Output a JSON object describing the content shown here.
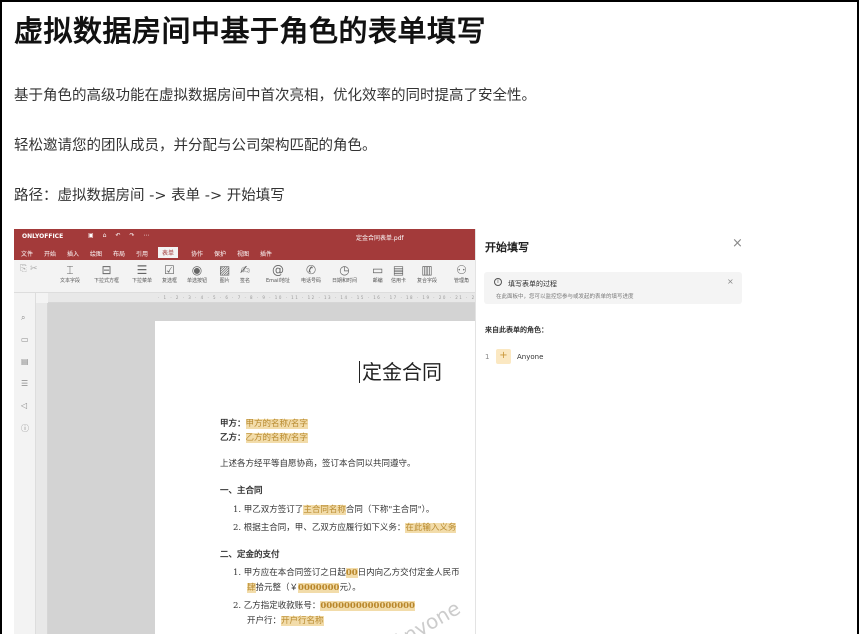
{
  "article": {
    "title": "虚拟数据房间中基于角色的表单填写",
    "paragraphs": [
      "基于角色的高级功能在虚拟数据房间中首次亮相，优化效率的同时提高了安全性。",
      "轻松邀请您的团队成员，并分配与公司架构匹配的角色。",
      "路径：虚拟数据房间 -> 表单 -> 开始填写"
    ]
  },
  "app": {
    "logo": "ONLYOFFICE",
    "document_name": "定金合同表单.pdf",
    "brand_color": "#a33a3a",
    "menu": [
      "文件",
      "开始",
      "插入",
      "绘图",
      "布局",
      "引用",
      "表单",
      "协作",
      "保护",
      "视图",
      "插件"
    ],
    "active_menu": "表单",
    "ribbon": [
      {
        "label": "文本字段",
        "icon": "text-field-icon",
        "glyph": "⌶"
      },
      {
        "label": "下拉式方框",
        "icon": "combo-box-icon",
        "glyph": "⊟"
      },
      {
        "label": "下拉菜单",
        "icon": "dropdown-icon",
        "glyph": "☰"
      },
      {
        "label": "复选框",
        "icon": "checkbox-icon",
        "glyph": "☑"
      },
      {
        "label": "单选按钮",
        "icon": "radio-icon",
        "glyph": "◉"
      },
      {
        "label": "图片",
        "icon": "image-icon",
        "glyph": "▨"
      },
      {
        "label": "签名",
        "icon": "signature-icon",
        "glyph": "✍"
      },
      {
        "label": "Email地址",
        "icon": "email-icon",
        "glyph": "@"
      },
      {
        "label": "电话号码",
        "icon": "phone-icon",
        "glyph": "✆"
      },
      {
        "label": "日期和时间",
        "icon": "datetime-icon",
        "glyph": "◷"
      },
      {
        "label": "邮编",
        "icon": "zip-icon",
        "glyph": "▭"
      },
      {
        "label": "信用卡",
        "icon": "credit-card-icon",
        "glyph": "▤"
      },
      {
        "label": "复合字段",
        "icon": "complex-field-icon",
        "glyph": "▥"
      },
      {
        "label": "管理角",
        "icon": "manage-roles-icon",
        "glyph": "⚇"
      }
    ]
  },
  "document": {
    "title": "定金合同",
    "party_a_label": "甲方：",
    "party_a_value": "甲方的名称/名字",
    "party_b_label": "乙方：",
    "party_b_value": "乙方的名称/名字",
    "intro": "上述各方经平等自愿协商，签订本合同以共同遵守。",
    "section1_heading": "一、主合同",
    "s1_item1_pre": "1.  甲乙双方签订了",
    "s1_item1_field": "主合同名称",
    "s1_item1_post": "合同（下称\"主合同\"）。",
    "s1_item2_pre": "2.  根据主合同，甲、乙双方应履行如下义务：",
    "s1_item2_field": "在此输入义务",
    "section2_heading": "二、定金的支付",
    "s2_item1_pre": "1.  甲方应在本合同签订之日起",
    "s2_item1_days": "00",
    "s2_item1_post": "日内向乙方交付定金人民币",
    "s2_item1_line2_field": "肆",
    "s2_item1_line2_mid": "拾元整（￥",
    "s2_item1_amount": "0000000",
    "s2_item1_line2_post": "元）。",
    "s2_item2_pre": "2.  乙方指定收款账号：",
    "s2_item2_account": "0000000000000000",
    "s2_item2_bank_label": "开户行：",
    "s2_item2_bank_value": "开户行名称",
    "watermark": "Anyone"
  },
  "panel": {
    "title": "开始填写",
    "info_title": "填写表单的过程",
    "info_desc": "在此面板中，您可以监控您参与或发起的表单的填写进度",
    "roles_label": "来自此表单的角色：",
    "roles": [
      {
        "index": "1",
        "name": "Anyone",
        "color": "#fbe8c2"
      }
    ]
  }
}
